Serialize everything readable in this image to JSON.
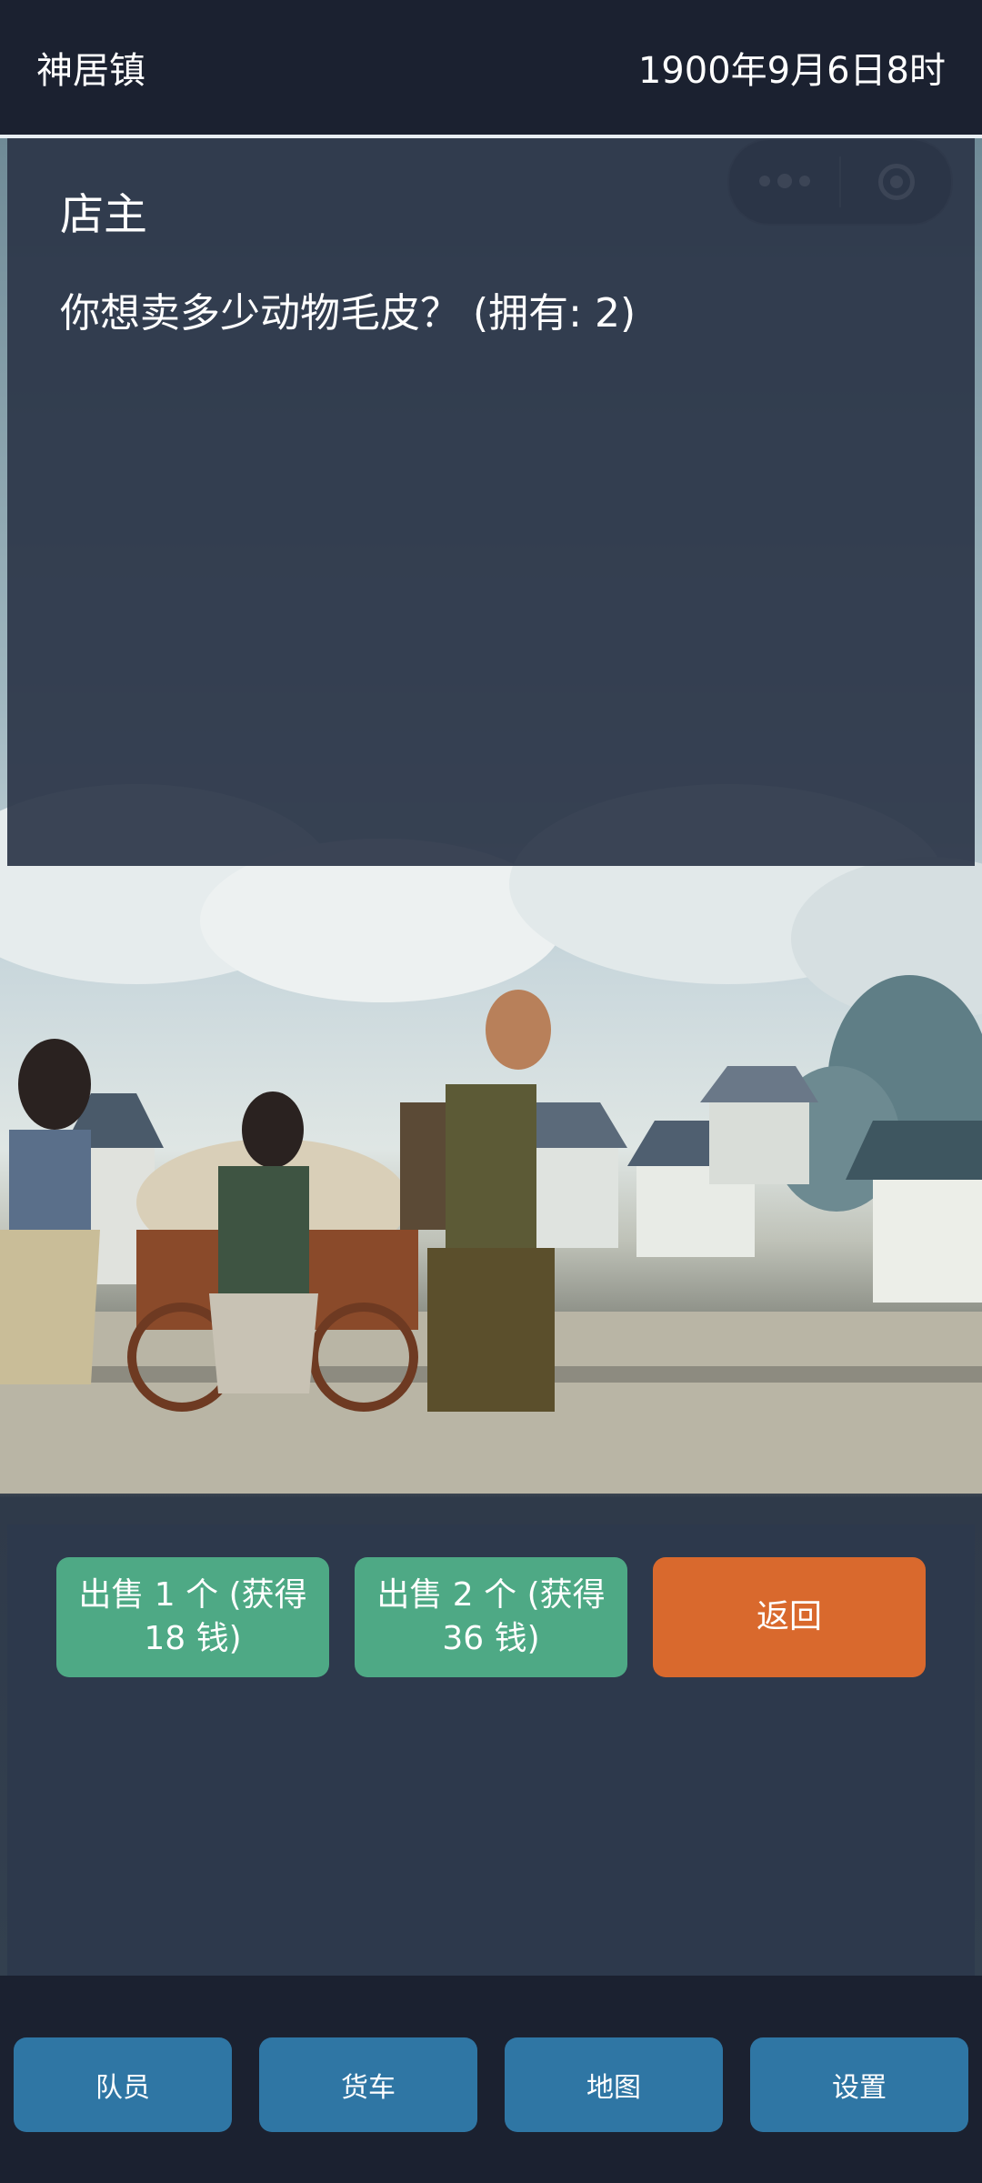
{
  "header": {
    "location": "神居镇",
    "datetime": "1900年9月6日8时"
  },
  "dialog": {
    "speaker": "店主",
    "question": "你想卖多少动物毛皮？ (拥有: 2)"
  },
  "actions": [
    {
      "label": "出售 1 个 (获得 18 钱)",
      "color": "#4ea985"
    },
    {
      "label": "出售 2 个 (获得 36 钱)",
      "color": "#4ea985"
    },
    {
      "label": "返回",
      "color": "#d9692d"
    }
  ],
  "nav": [
    {
      "label": "队员"
    },
    {
      "label": "货车"
    },
    {
      "label": "地图"
    },
    {
      "label": "设置"
    }
  ],
  "capsule": {
    "menu_icon": "more-dots-icon",
    "close_icon": "target-circle-icon"
  },
  "colors": {
    "header_bg": "#1b2130",
    "panel_bg": "#2b3548",
    "accent_green": "#4ea985",
    "accent_orange": "#d9692d",
    "nav_blue": "#2f76a4"
  }
}
